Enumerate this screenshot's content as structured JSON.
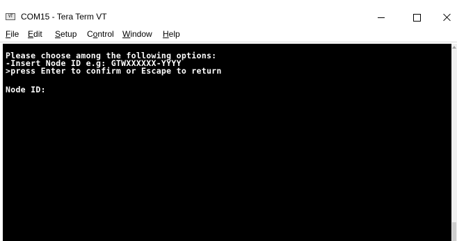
{
  "window": {
    "title": "COM15 - Tera Term VT",
    "icon_label": "VT",
    "icon": "teraterm-vt-icon"
  },
  "menu": {
    "items": [
      {
        "label": "File",
        "mnemonic": "F",
        "rest": "ile"
      },
      {
        "label": "Edit",
        "mnemonic": "E",
        "rest": "dit"
      },
      {
        "label": "Setup",
        "mnemonic": "S",
        "rest": "etup"
      },
      {
        "label": "Control",
        "pre": "C",
        "mnemonic": "o",
        "rest": "ntrol"
      },
      {
        "label": "Window",
        "mnemonic": "W",
        "rest": "indow"
      },
      {
        "label": "Help",
        "mnemonic": "H",
        "rest": "elp"
      }
    ]
  },
  "terminal": {
    "lines": [
      "Please choose among the following options:",
      "-Insert Node ID e.g: GTWXXXXXX-YYYY",
      ">press Enter to confirm or Escape to return",
      "",
      "Node ID:"
    ],
    "background": "#000000",
    "foreground": "#ffffff"
  },
  "caption_buttons": {
    "minimize": "minimize-icon",
    "maximize": "maximize-icon",
    "close": "close-icon"
  }
}
